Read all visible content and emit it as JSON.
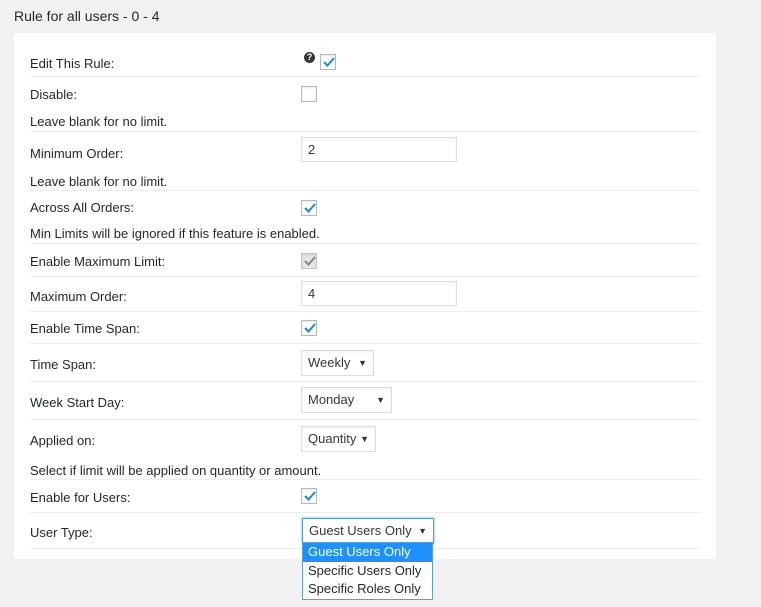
{
  "header": {
    "title": "Rule for all users - 0 - 4"
  },
  "fields": {
    "edit_rule": {
      "label": "Edit This Rule:",
      "checked": true,
      "help_icon": "question-circle-icon"
    },
    "disable": {
      "label": "Disable:",
      "checked": false
    },
    "min_note": "Leave blank for no limit.",
    "minimum_order": {
      "label": "Minimum Order:",
      "value": "2"
    },
    "across_note": "Leave blank for no limit.",
    "across_all_orders": {
      "label": "Across All Orders:",
      "checked": true
    },
    "max_note": "Min Limits will be ignored if this feature is enabled.",
    "enable_max_limit": {
      "label": "Enable Maximum Limit:",
      "checked": true,
      "disabled": true
    },
    "maximum_order": {
      "label": "Maximum Order:",
      "value": "4"
    },
    "enable_time_span": {
      "label": "Enable Time Span:",
      "checked": true
    },
    "time_span": {
      "label": "Time Span:",
      "value": "Weekly"
    },
    "week_start_day": {
      "label": "Week Start Day:",
      "value": "Monday"
    },
    "applied_on": {
      "label": "Applied on:",
      "value": "Quantity"
    },
    "applied_note": "Select if limit will be applied on quantity or amount.",
    "enable_for_users": {
      "label": "Enable for Users:",
      "checked": true
    },
    "user_type": {
      "label": "User Type:",
      "value": "Guest Users Only",
      "options": [
        "Guest Users Only",
        "Specific Users Only",
        "Specific Roles Only"
      ],
      "selected_index": 0
    }
  },
  "colors": {
    "accent": "#1e8cbe",
    "check": "#1e8cbe",
    "highlight": "#1e90ff"
  }
}
